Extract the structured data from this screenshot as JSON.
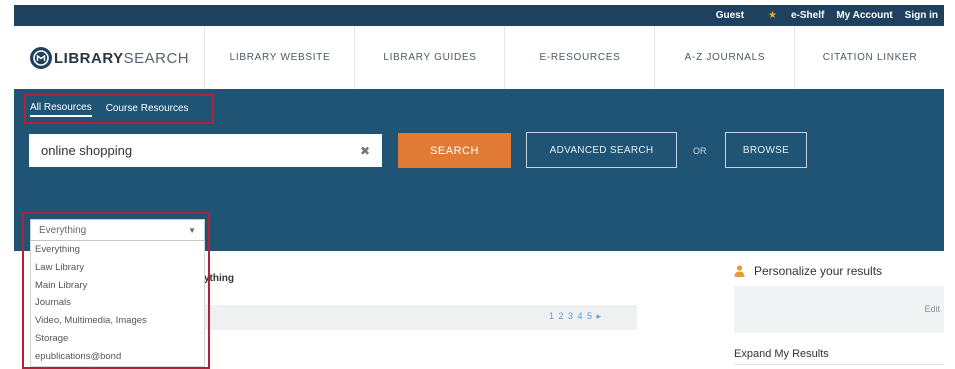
{
  "topbar": {
    "guest": "Guest",
    "eshelf": "e-Shelf",
    "my_account": "My Account",
    "sign_in": "Sign in"
  },
  "logo": {
    "text_bold": "LIBRARY",
    "text_light": "SEARCH"
  },
  "nav": [
    {
      "label": "LIBRARY WEBSITE"
    },
    {
      "label": "LIBRARY GUIDES"
    },
    {
      "label": "E-RESOURCES"
    },
    {
      "label": "A-Z JOURNALS"
    },
    {
      "label": "CITATION LINKER"
    }
  ],
  "scope_tabs": [
    {
      "label": "All Resources",
      "active": true
    },
    {
      "label": "Course Resources",
      "active": false
    }
  ],
  "search": {
    "value": "online shopping",
    "clear_glyph": "✖",
    "button": "SEARCH",
    "advanced": "ADVANCED SEARCH",
    "or": "OR",
    "browse": "BROWSE"
  },
  "dropdown": {
    "selected": "Everything",
    "options": [
      "Everything",
      "Law Library",
      "Main Library",
      "Journals",
      "Video, Multimedia, Images",
      "Storage",
      "epublications@bond"
    ]
  },
  "results": {
    "heading_fragment": "ything",
    "pager": "1 2 3 4 5 ▸"
  },
  "sidebar": {
    "personalize": "Personalize your results",
    "edit": "Edit",
    "expand": "Expand My Results"
  },
  "colors": {
    "topbar": "#1f4160",
    "panel": "#1f5475",
    "search_button": "#e07a34",
    "highlight_box": "#b3213a"
  }
}
